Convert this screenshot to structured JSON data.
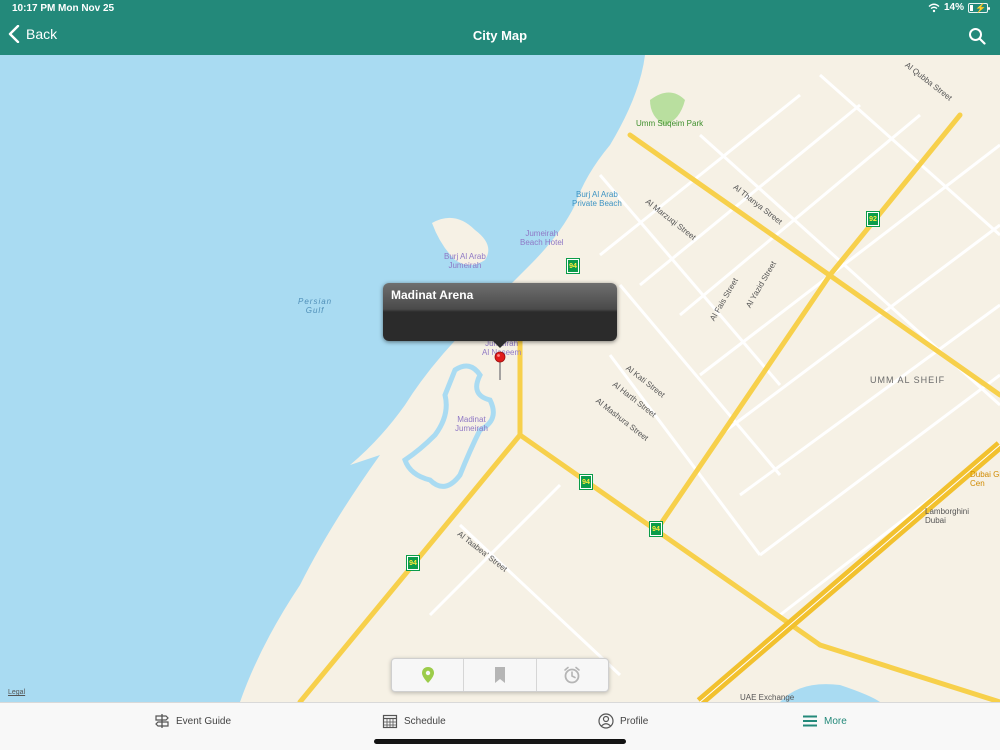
{
  "status": {
    "time": "10:17 PM",
    "date": "Mon Nov 25",
    "battery": "14%"
  },
  "nav": {
    "back_label": "Back",
    "title": "City Map"
  },
  "map": {
    "labels": {
      "umm_suqeim_park": "Umm Suqeim Park",
      "burj_al_arab_private_beach": [
        "Burj Al Arab",
        "Private Beach"
      ],
      "jumeirah_beach_hotel": [
        "Jumeirah",
        "Beach Hotel"
      ],
      "burj_al_arab_jumeirah": [
        "Burj Al Arab",
        "Jumeirah"
      ],
      "persian_gulf": [
        "Persian",
        "Gulf"
      ],
      "jumeirah_al_naseem": [
        "Jumeirah",
        "Al Naseem"
      ],
      "madinat_jumeirah": [
        "Madinat",
        "Jumeirah"
      ],
      "umm_al_sheif": "UMM AL SHEIF",
      "lamborghini_dubai": [
        "Lamborghini",
        "Dubai"
      ],
      "uae_exchange": "UAE Exchange",
      "al_thanya_street": "Al Thanya Street",
      "al_taabea_street": "Al Taabea' Street",
      "al_marzuqi_street": "Al Marzuqi Street",
      "al_kati_street": "Al Kati Street",
      "al_harth_street": "Al Harth Street",
      "al_mashura_street": "Al Mashura Street",
      "al_qubba_street": "Al Qubba Street",
      "al_yazid_street": "Al Yazid Street",
      "al_fais_street": "Al Fais Street",
      "dubai_gold": [
        "Dubai Gi",
        "Cen"
      ]
    },
    "route_shields": [
      "94",
      "92",
      "94",
      "94",
      "94"
    ],
    "legal": "Legal"
  },
  "callout": {
    "title": "Madinat Arena"
  },
  "segmented": {
    "items": [
      "map-pin-icon",
      "bookmark-icon",
      "alarm-clock-icon"
    ],
    "active": "map-pin-icon"
  },
  "tabs": [
    {
      "label": "Event Guide",
      "icon": "signpost-icon"
    },
    {
      "label": "Schedule",
      "icon": "calendar-icon"
    },
    {
      "label": "Profile",
      "icon": "person-icon"
    },
    {
      "label": "More",
      "icon": "menu-icon",
      "active": true
    }
  ],
  "colors": {
    "accent": "#23897a",
    "water": "#a9dbf2",
    "land": "#f6f1e5",
    "highway": "#f7d04b"
  }
}
